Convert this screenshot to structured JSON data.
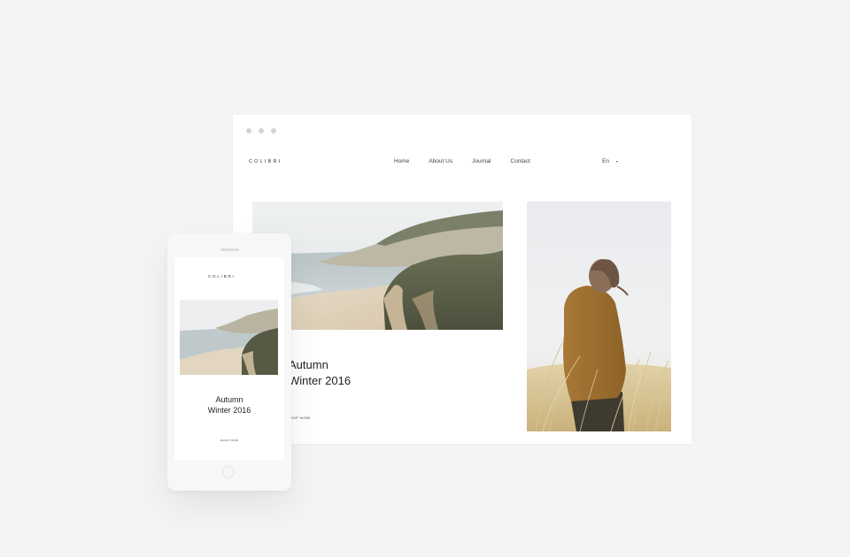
{
  "desktop": {
    "brand": "COLIBRI",
    "nav": [
      {
        "label": "Home"
      },
      {
        "label": "About Us"
      },
      {
        "label": "Journal"
      },
      {
        "label": "Contact"
      }
    ],
    "language": "En",
    "heading_line1": "Autumn",
    "heading_line2": "Winter 2016",
    "cta": "HOP NOW"
  },
  "mobile": {
    "brand": "COLIBRI",
    "heading_line1": "Autumn",
    "heading_line2": "Winter 2016",
    "cta": "SHOP NOW"
  },
  "colors": {
    "background": "#f4f4f4",
    "card": "#ffffff",
    "text": "#222222"
  }
}
